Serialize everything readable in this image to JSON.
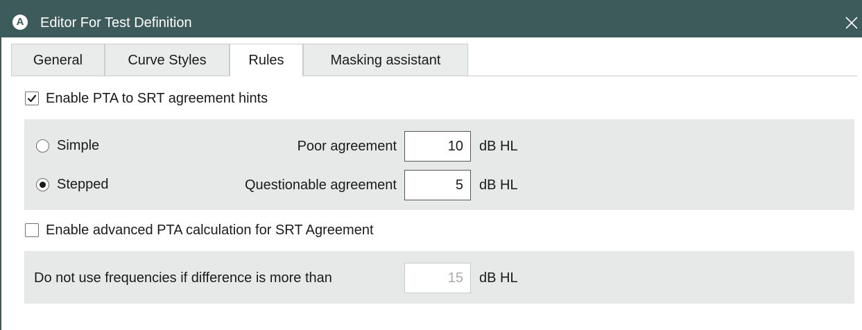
{
  "window": {
    "title": "Editor For Test Definition",
    "app_icon_letter": "A",
    "colors": {
      "titlebar": "#3e5b5b",
      "panel": "#e7e9e9",
      "tab_inactive": "#eaecec"
    }
  },
  "tabs": [
    {
      "label": "General",
      "active": false
    },
    {
      "label": "Curve Styles",
      "active": false
    },
    {
      "label": "Rules",
      "active": true
    },
    {
      "label": "Masking assistant",
      "active": false
    }
  ],
  "rules": {
    "pta_srt_hints": {
      "label": "Enable PTA to SRT agreement hints",
      "checked": true
    },
    "mode": {
      "simple_label": "Simple",
      "stepped_label": "Stepped",
      "selected": "Stepped"
    },
    "poor_agreement": {
      "label": "Poor agreement",
      "value": "10",
      "unit": "dB HL"
    },
    "questionable_agreement": {
      "label": "Questionable agreement",
      "value": "5",
      "unit": "dB HL"
    },
    "advanced_pta": {
      "label": "Enable advanced PTA calculation for SRT Agreement",
      "checked": false
    },
    "frequency_difference": {
      "label": "Do not use frequencies if difference is more than",
      "value": "15",
      "unit": "dB HL",
      "disabled": true
    }
  }
}
